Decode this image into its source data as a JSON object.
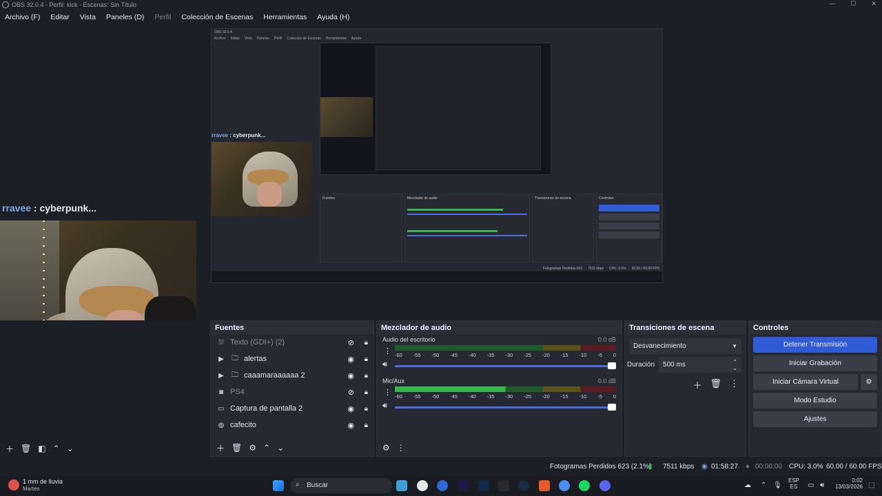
{
  "window": {
    "title": "OBS 32.0.4 - Perfil: kick - Escenas: Sin Título"
  },
  "menu": {
    "items": [
      "Archivo (F)",
      "Editar",
      "Vista",
      "Paneles (D)",
      "Perfil",
      "Colección de Escenas",
      "Herramientas",
      "Ayuda (H)"
    ]
  },
  "chat": {
    "name": "rravee",
    "sep": " : ",
    "message": "cyberpunk..."
  },
  "sources": {
    "title": "Fuentes",
    "rows": [
      {
        "label": "Texto (GDI+) (2)",
        "icon": "text-icon"
      },
      {
        "label": "alertas",
        "icon": "folder-icon"
      },
      {
        "label": "caaamaraaaaaa 2",
        "icon": "folder-icon"
      },
      {
        "label": "PS4",
        "icon": "camera-icon"
      },
      {
        "label": "Captura de pantalla 2",
        "icon": "monitor-icon"
      },
      {
        "label": "cafecito",
        "icon": "browser-icon"
      }
    ]
  },
  "mixer": {
    "title": "Mezclador de audio",
    "channels": [
      {
        "name": "Audio del escritorio",
        "db": "0.0 dB"
      },
      {
        "name": "Mic/Aux",
        "db": "0.0 dB"
      }
    ],
    "scale": [
      "-60",
      "-55",
      "-50",
      "-45",
      "-40",
      "-35",
      "-30",
      "-25",
      "-20",
      "-15",
      "-10",
      "-5",
      "0"
    ]
  },
  "transitions": {
    "title": "Transiciones de escena",
    "selected": "Desvanecimiento",
    "duration_label": "Duración",
    "duration_value": "500 ms"
  },
  "controls": {
    "title": "Controles",
    "stop_stream": "Detener Transmisión",
    "start_record": "Iniciar Grabación",
    "virtual_cam": "Iniciar Cámara Virtual",
    "studio_mode": "Modo Estudio",
    "settings": "Ajustes"
  },
  "status": {
    "dropped": "Fotogramas Perdidos 623 (2.1%)",
    "kbps": "7511 kbps",
    "stream_time": "01:58:27",
    "rec_time": "00:00:00",
    "cpu": "CPU: 3.0%",
    "fps": "60.00 / 60.00 FPS"
  },
  "taskbar": {
    "weather": "1 mm de lluvia",
    "weather_sub": "Martes",
    "search": "Buscar",
    "lang": "ESP",
    "lang_sub": "ES",
    "time": "0:02",
    "date": "13/03/2026"
  },
  "colors": {
    "accent": "#2f5bd6",
    "meter_green": "#36b84a",
    "meter_yellow": "#b5a52a",
    "meter_red": "#a12a3a"
  }
}
